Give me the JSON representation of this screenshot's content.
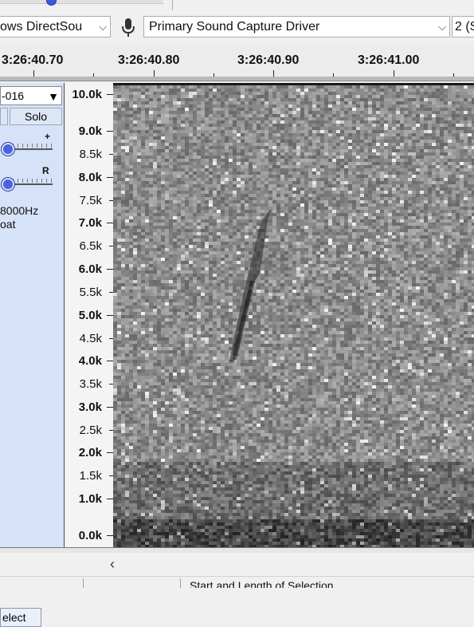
{
  "device_toolbar": {
    "host": "ows DirectSou",
    "input_device": "Primary Sound Capture Driver",
    "channels": "2 (S"
  },
  "timeline": {
    "labels": [
      "3:26:40.70",
      "3:26:40.80",
      "3:26:40.90",
      "3:26:41.00"
    ]
  },
  "track": {
    "name": "-016",
    "solo_label": "Solo",
    "gain_plus": "+",
    "pan_right": "R",
    "sample_rate": "8000Hz",
    "format": "oat",
    "select_label": "elect"
  },
  "frequency_axis": {
    "labels": [
      "10.0k",
      "9.0k",
      "8.5k",
      "8.0k",
      "7.5k",
      "7.0k",
      "6.5k",
      "6.0k",
      "5.5k",
      "5.0k",
      "4.5k",
      "4.0k",
      "3.5k",
      "3.0k",
      "2.5k",
      "2.0k",
      "1.5k",
      "1.0k",
      "0.0k"
    ],
    "major": [
      "10.0k",
      "9.0k",
      "8.0k",
      "7.0k",
      "6.0k",
      "5.0k",
      "4.0k",
      "3.0k",
      "2.0k",
      "1.0k",
      "0.0k"
    ]
  },
  "status": {
    "text": "Start and Length of Selection"
  },
  "colors": {
    "track_panel": "#d6e2f7",
    "slider_thumb": "#4a62e0",
    "spectrogram_base": "#8a8a8a"
  },
  "icons": [
    "chevron-down-icon",
    "microphone-icon",
    "chevron-left-icon",
    "dropdown-triangle-icon"
  ]
}
